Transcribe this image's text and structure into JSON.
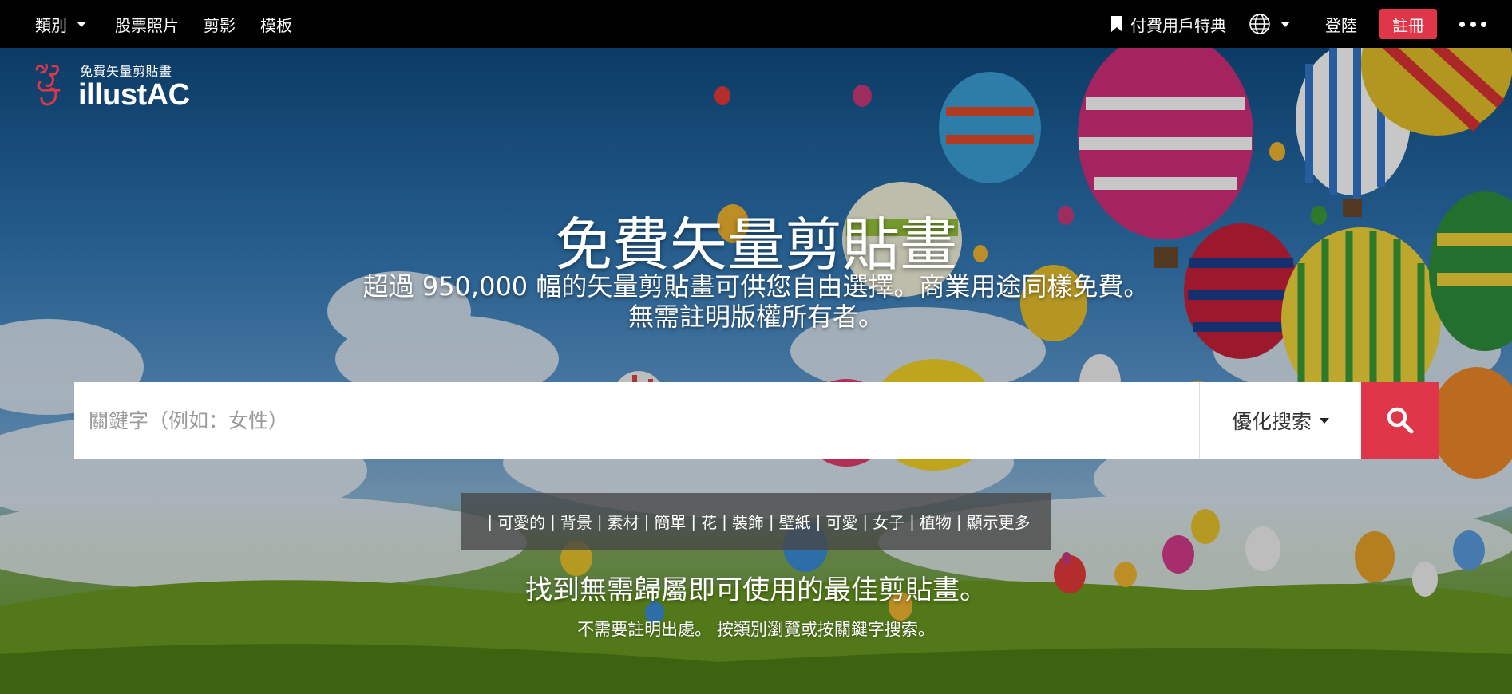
{
  "topnav": {
    "category_label": "類別",
    "stock_photos_label": "股票照片",
    "silhouette_label": "剪影",
    "templates_label": "模板",
    "premium_label": "付費用戶特典",
    "login_label": "登陸",
    "register_label": "註冊"
  },
  "logo": {
    "tagline": "免費矢量剪貼畫",
    "name": "illustAC"
  },
  "hero": {
    "title": "免費矢量剪貼畫",
    "subtitle_line1": "超過 950,000 幅的矢量剪貼畫可供您自由選擇。商業用途同樣免費。",
    "subtitle_line2": "無需註明版權所有者。"
  },
  "search": {
    "placeholder": "關鍵字（例如：女性）",
    "value": "",
    "refine_label": "優化搜索"
  },
  "tags": {
    "items": [
      "可愛的",
      "背景",
      "素材",
      "簡單",
      "花",
      "裝飾",
      "壁紙",
      "可愛",
      "女子",
      "植物",
      "顯示更多"
    ]
  },
  "bottom": {
    "title": "找到無需歸屬即可使用的最佳剪貼畫。",
    "subtitle": "不需要註明出處。 按類別瀏覽或按關鍵字搜索。"
  },
  "colors": {
    "accent": "#e0364a",
    "nav_bg": "#000000",
    "tag_bar_bg": "#464646"
  },
  "icons": [
    "bookmark-icon",
    "globe-icon",
    "more-icon",
    "search-icon",
    "logo-icon"
  ]
}
